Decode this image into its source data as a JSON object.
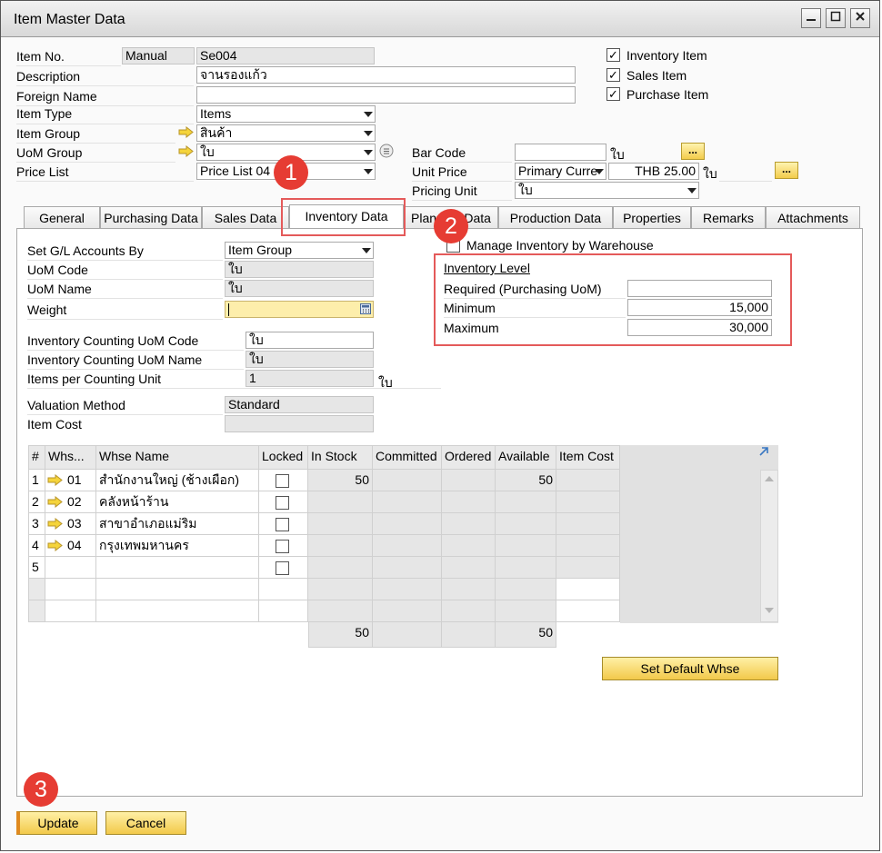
{
  "window": {
    "title": "Item Master Data"
  },
  "header": {
    "item_no_label": "Item No.",
    "item_no_series": "Manual",
    "item_no_value": "Se004",
    "description_label": "Description",
    "description_value": "จานรองแก้ว",
    "foreign_name_label": "Foreign Name",
    "foreign_name_value": "",
    "item_type_label": "Item Type",
    "item_type_value": "Items",
    "item_group_label": "Item Group",
    "item_group_value": "สินค้า",
    "uom_group_label": "UoM Group",
    "uom_group_value": "ใบ",
    "price_list_label": "Price List",
    "price_list_value": "Price List 04",
    "bar_code_label": "Bar Code",
    "bar_code_value": "",
    "bar_code_unit": "ใบ",
    "unit_price_label": "Unit Price",
    "unit_price_currency": "Primary Curre",
    "unit_price_value": "THB 25.00",
    "unit_price_unit": "ใบ",
    "pricing_unit_label": "Pricing Unit",
    "pricing_unit_value": "ใบ",
    "ellipsis": "...",
    "inventory_item_label": "Inventory Item",
    "sales_item_label": "Sales Item",
    "purchase_item_label": "Purchase Item",
    "check_mark": "✓"
  },
  "tabs": [
    "General",
    "Purchasing Data",
    "Sales Data",
    "Inventory Data",
    "Planning Data",
    "Production Data",
    "Properties",
    "Remarks",
    "Attachments"
  ],
  "inventory": {
    "gl_label": "Set G/L Accounts By",
    "gl_value": "Item Group",
    "uom_code_label": "UoM Code",
    "uom_code_value": "ใบ",
    "uom_name_label": "UoM Name",
    "uom_name_value": "ใบ",
    "weight_label": "Weight",
    "weight_value": "",
    "counting_code_label": "Inventory Counting UoM Code",
    "counting_code_value": "ใบ",
    "counting_name_label": "Inventory Counting UoM Name",
    "counting_name_value": "ใบ",
    "items_per_label": "Items per Counting Unit",
    "items_per_value": "1",
    "items_per_unit": "ใบ",
    "valuation_label": "Valuation Method",
    "valuation_value": "Standard",
    "item_cost_label": "Item Cost",
    "item_cost_value": "",
    "manage_label": "Manage Inventory by Warehouse",
    "level_title": "Inventory Level",
    "required_label": "Required (Purchasing UoM)",
    "required_value": "",
    "minimum_label": "Minimum",
    "minimum_value": "15,000",
    "maximum_label": "Maximum",
    "maximum_value": "30,000"
  },
  "grid": {
    "headers": [
      "#",
      "Whs...",
      "Whse Name",
      "Locked",
      "In Stock",
      "Committed",
      "Ordered",
      "Available",
      "Item Cost"
    ],
    "rows": [
      {
        "num": "1",
        "code": "01",
        "name": "สำนักงานใหญ่ (ช้างเผือก)",
        "in_stock": "50",
        "available": "50"
      },
      {
        "num": "2",
        "code": "02",
        "name": "คลังหน้าร้าน",
        "in_stock": "",
        "available": ""
      },
      {
        "num": "3",
        "code": "03",
        "name": "สาขาอำเภอแม่ริม",
        "in_stock": "",
        "available": ""
      },
      {
        "num": "4",
        "code": "04",
        "name": "กรุงเทพมหานคร",
        "in_stock": "",
        "available": ""
      },
      {
        "num": "5",
        "code": "",
        "name": "",
        "in_stock": "",
        "available": ""
      }
    ],
    "total_in_stock": "50",
    "total_available": "50"
  },
  "buttons": {
    "set_default": "Set Default Whse",
    "update": "Update",
    "cancel": "Cancel"
  },
  "badges": [
    "1",
    "2",
    "3"
  ],
  "colors": {
    "annotation_red": "#e63c33",
    "button_yellow": "#f2c94a"
  }
}
